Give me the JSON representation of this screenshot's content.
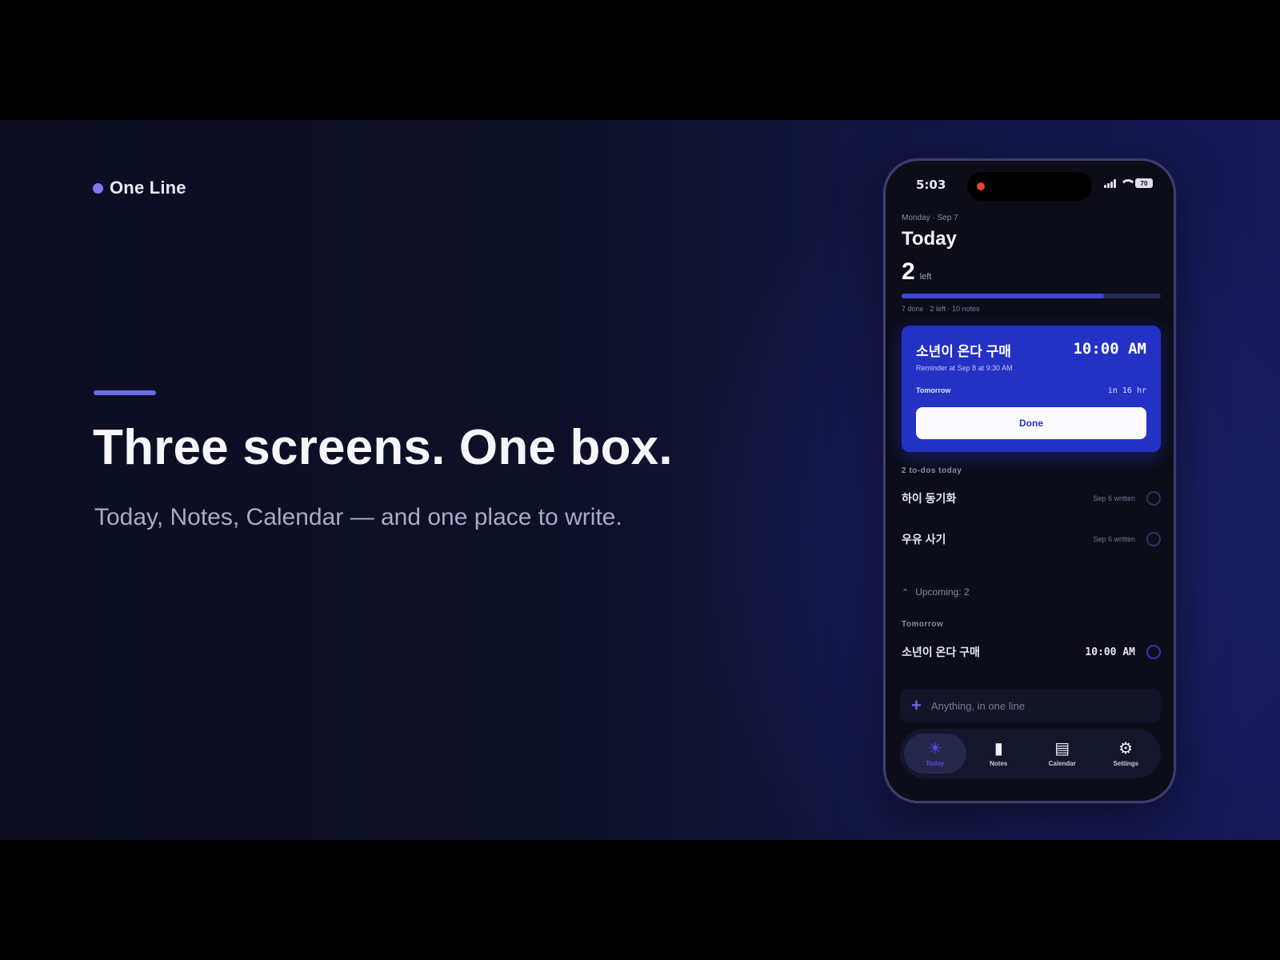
{
  "brand": {
    "name": "One Line"
  },
  "hero": {
    "headline": "Three screens. One box.",
    "subhead": "Today, Notes, Calendar — and one place to write."
  },
  "phone": {
    "status": {
      "time": "5:03",
      "battery": "70"
    },
    "date": "Monday · Sep 7",
    "title": "Today",
    "left_count": "2",
    "left_label": "left",
    "progress": 0.78,
    "stats": "7 done · 2 left · 10 notes",
    "card": {
      "title": "소년이 온다 구매",
      "time": "10:00 AM",
      "reminder": "Reminder at Sep 8 at 9:30 AM",
      "tomorrow": "Tomorrow",
      "in": "in 16 hr",
      "done_label": "Done"
    },
    "todos_label": "2 to-dos today",
    "todos": [
      {
        "text": "하이 동기화",
        "meta": "Sep 6 written"
      },
      {
        "text": "우유 사기",
        "meta": "Sep 6 written"
      }
    ],
    "upcoming_label": "Upcoming: 2",
    "tomorrow_label": "Tomorrow",
    "upcoming_items": [
      {
        "text": "소년이 온다 구매",
        "time": "10:00 AM"
      }
    ],
    "compose_placeholder": "Anything, in one line",
    "tabs": [
      {
        "label": "Today",
        "icon": "sun-icon"
      },
      {
        "label": "Notes",
        "icon": "note-icon"
      },
      {
        "label": "Calendar",
        "icon": "calendar-icon"
      },
      {
        "label": "Settings",
        "icon": "gear-icon"
      }
    ],
    "colors": {
      "accent": "#2332c4",
      "brand": "#7b78f2"
    }
  }
}
